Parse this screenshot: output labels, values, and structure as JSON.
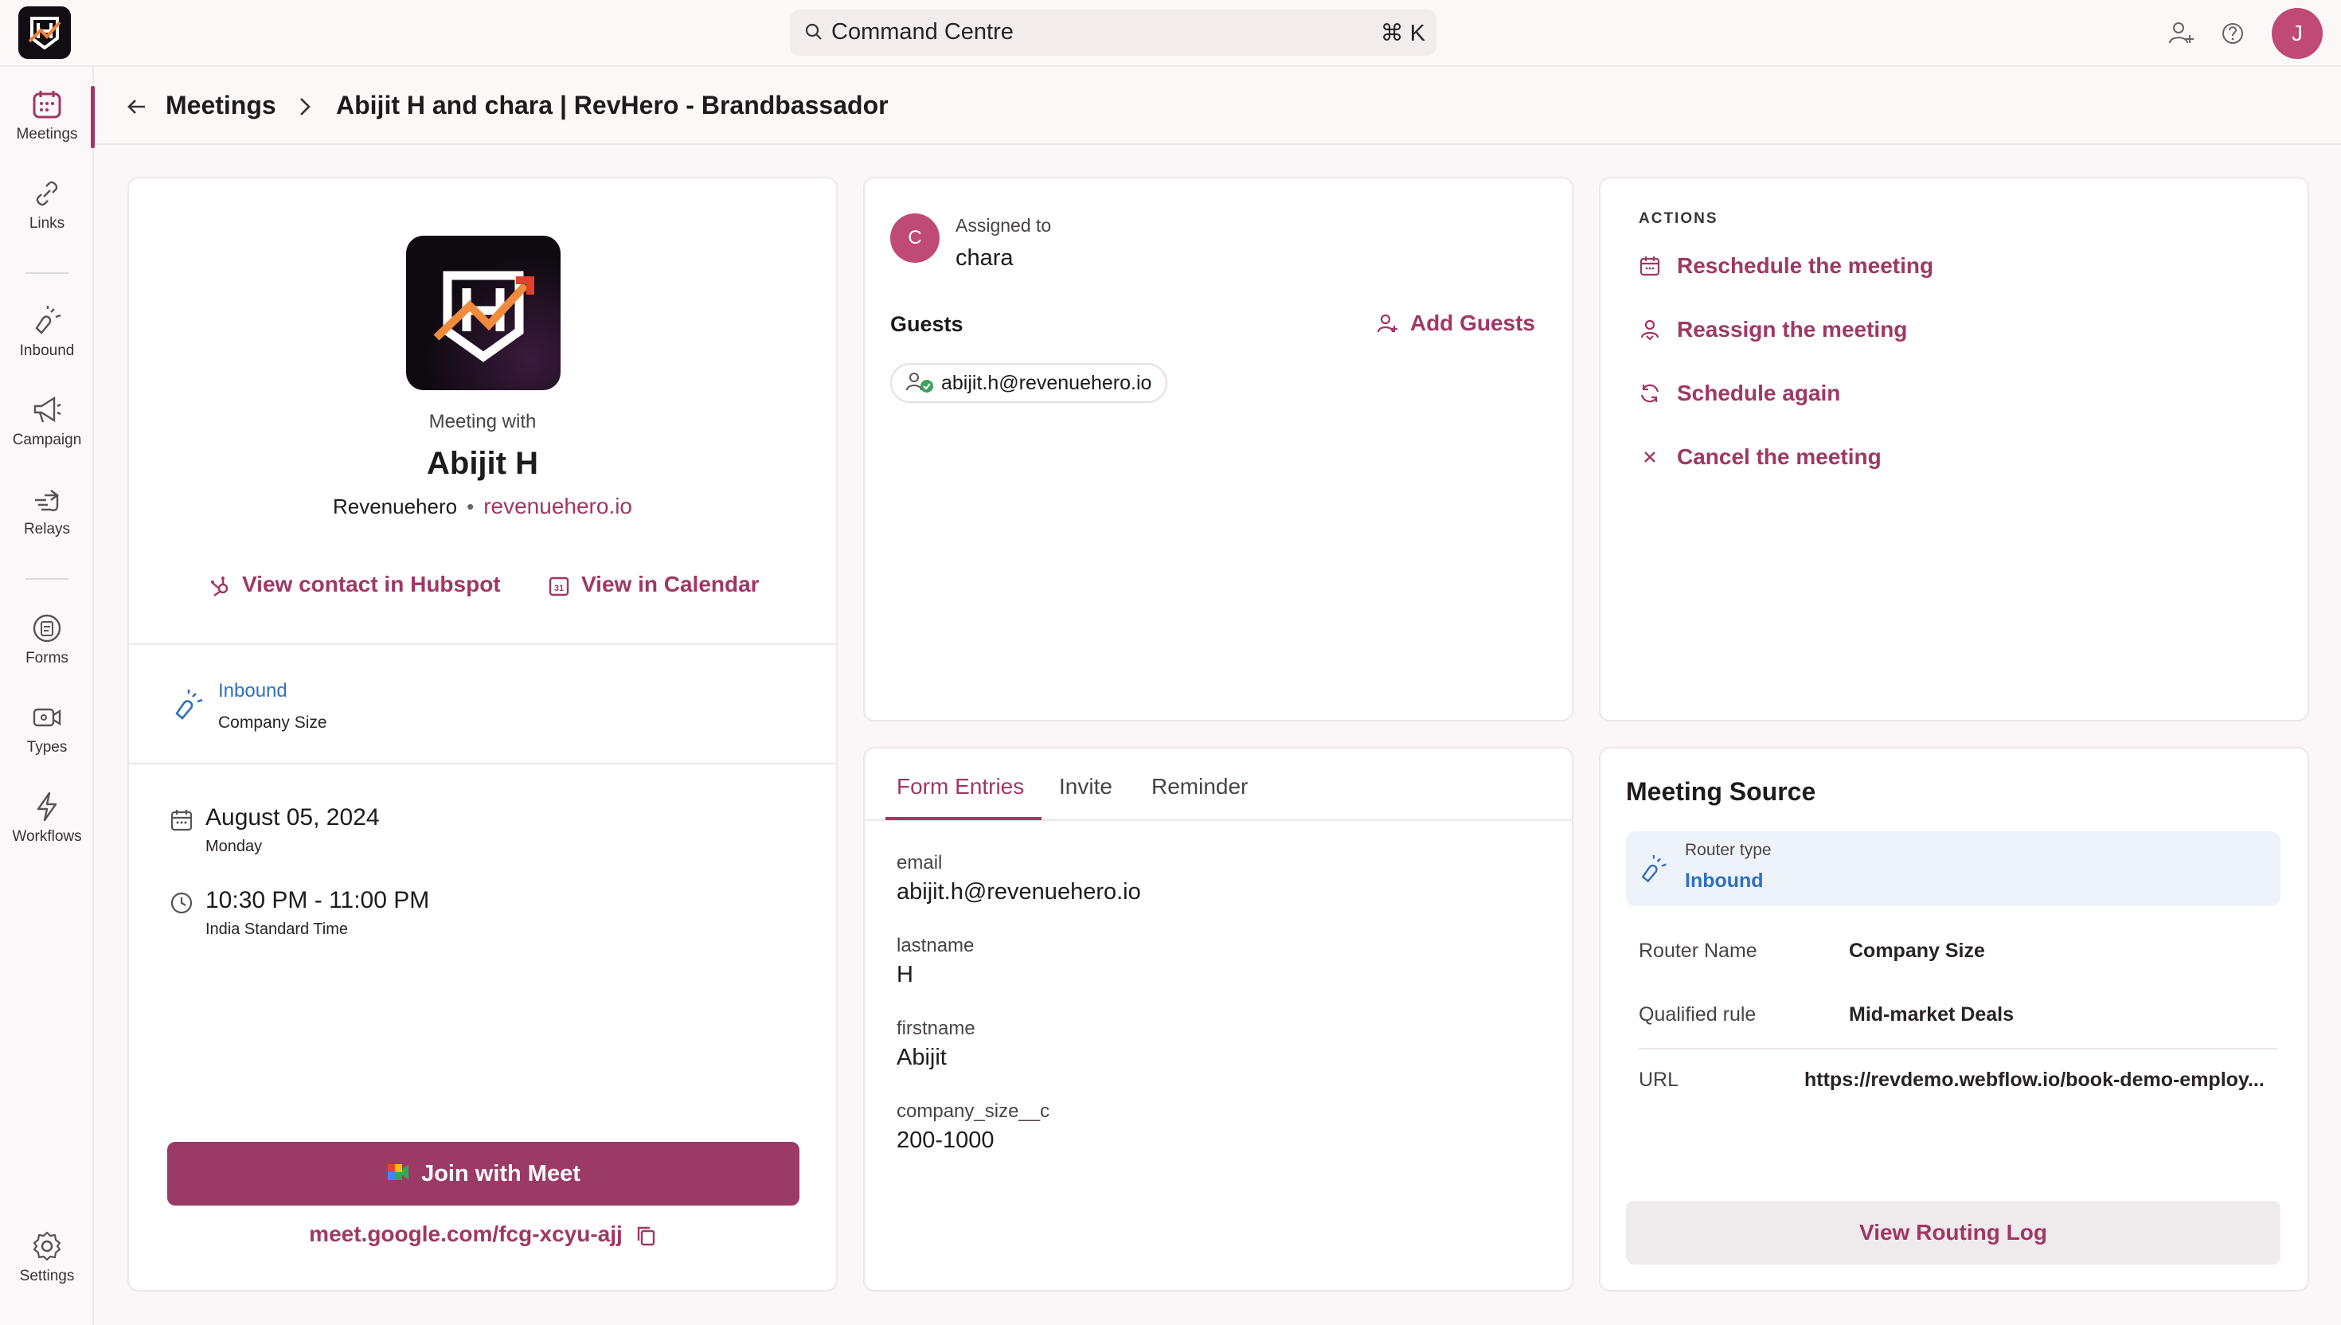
{
  "search": {
    "placeholder": "Command Centre",
    "shortcut": "⌘ K"
  },
  "user": {
    "initial": "J"
  },
  "sidebar": {
    "items": [
      {
        "label": "Meetings",
        "icon": "calendar-icon",
        "active": true
      },
      {
        "label": "Links",
        "icon": "link-icon"
      },
      {
        "label": "Inbound",
        "icon": "inbound-icon"
      },
      {
        "label": "Campaign",
        "icon": "megaphone-icon"
      },
      {
        "label": "Relays",
        "icon": "relay-icon"
      },
      {
        "label": "Forms",
        "icon": "form-icon"
      },
      {
        "label": "Types",
        "icon": "video-icon"
      },
      {
        "label": "Workflows",
        "icon": "bolt-icon"
      },
      {
        "label": "Settings",
        "icon": "gear-icon"
      }
    ]
  },
  "breadcrumb": {
    "parent": "Meetings",
    "current": "Abijit H and chara | RevHero -  Brandbassador"
  },
  "meeting": {
    "with_label": "Meeting with",
    "name": "Abijit H",
    "company": "Revenuehero",
    "domain": "revenuehero.io",
    "hubspot_link": "View contact in Hubspot",
    "calendar_link": "View in Calendar",
    "source_title": "Inbound",
    "source_sub": "Company Size",
    "date": "August 05, 2024",
    "day": "Monday",
    "time": "10:30 PM - 11:00 PM",
    "timezone": "India Standard Time",
    "join_label": "Join with Meet",
    "meet_url": "meet.google.com/fcg-xcyu-ajj"
  },
  "assignment": {
    "label": "Assigned to",
    "name": "chara",
    "initial": "C",
    "guests_heading": "Guests",
    "add_guests": "Add Guests",
    "guests": [
      "abijit.h@revenuehero.io"
    ]
  },
  "actions": {
    "heading": "ACTIONS",
    "items": [
      {
        "label": "Reschedule the meeting",
        "icon": "calendar-icon"
      },
      {
        "label": "Reassign the meeting",
        "icon": "reassign-icon"
      },
      {
        "label": "Schedule again",
        "icon": "refresh-icon"
      },
      {
        "label": "Cancel the meeting",
        "icon": "close-icon"
      }
    ]
  },
  "tabs": [
    "Form Entries",
    "Invite",
    "Reminder"
  ],
  "form_entries": [
    {
      "key": "email",
      "value": "abijit.h@revenuehero.io"
    },
    {
      "key": "lastname",
      "value": "H"
    },
    {
      "key": "firstname",
      "value": "Abijit"
    },
    {
      "key": "company_size__c",
      "value": "200-1000"
    }
  ],
  "meeting_source": {
    "heading": "Meeting Source",
    "router_type_label": "Router type",
    "router_type": "Inbound",
    "router_name_label": "Router Name",
    "router_name": "Company Size",
    "qualified_rule_label": "Qualified rule",
    "qualified_rule": "Mid-market Deals",
    "url_label": "URL",
    "url": "https://revdemo.webflow.io/book-demo-employ...",
    "routing_log_button": "View Routing Log"
  },
  "colors": {
    "accent": "#a03765",
    "link_blue": "#2f6fbf",
    "button": "#9b3a66"
  }
}
